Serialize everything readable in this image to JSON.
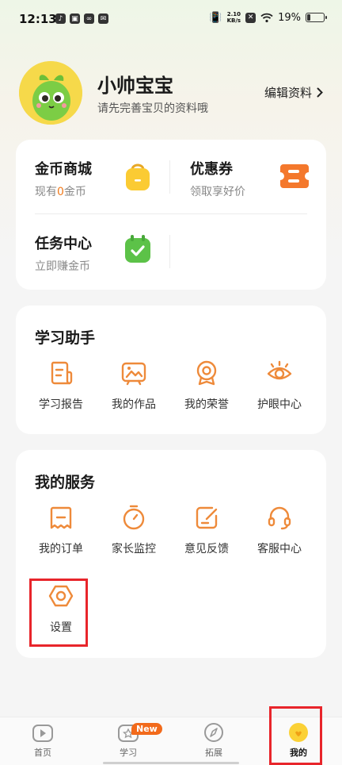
{
  "status_bar": {
    "time": "12:13",
    "speed_top": "2.10",
    "speed_bottom": "KB/s",
    "battery": "19%",
    "battery_level": 0.19
  },
  "profile": {
    "name": "小帅宝宝",
    "subtitle": "请先完善宝贝的资料哦",
    "edit_label": "编辑资料"
  },
  "rewards": {
    "coin_mall": {
      "title": "金币商城",
      "sub_prefix": "现有",
      "coin_count": "0",
      "sub_suffix": "金币"
    },
    "coupon": {
      "title": "优惠券",
      "sub": "领取享好价"
    },
    "task_center": {
      "title": "任务中心",
      "sub": "立即赚金币"
    }
  },
  "study_assistant": {
    "title": "学习助手",
    "items": [
      {
        "label": "学习报告",
        "icon": "report-icon"
      },
      {
        "label": "我的作品",
        "icon": "artwork-icon"
      },
      {
        "label": "我的荣誉",
        "icon": "medal-icon"
      },
      {
        "label": "护眼中心",
        "icon": "eye-icon"
      }
    ]
  },
  "my_services": {
    "title": "我的服务",
    "items": [
      {
        "label": "我的订单",
        "icon": "order-icon"
      },
      {
        "label": "家长监控",
        "icon": "timer-icon"
      },
      {
        "label": "意见反馈",
        "icon": "feedback-icon"
      },
      {
        "label": "客服中心",
        "icon": "headset-icon"
      },
      {
        "label": "设置",
        "icon": "settings-icon"
      }
    ]
  },
  "bottom_nav": {
    "items": [
      {
        "label": "首页",
        "icon": "home-play-icon"
      },
      {
        "label": "学习",
        "icon": "study-icon",
        "badge": "New"
      },
      {
        "label": "拓展",
        "icon": "compass-icon"
      },
      {
        "label": "我的",
        "icon": "mine-icon",
        "active": true
      }
    ]
  },
  "colors": {
    "accent_orange": "#f07a1c",
    "icon_orange": "#ee8a3a",
    "highlight_red": "#e8252b",
    "new_badge": "#f26a1b"
  }
}
